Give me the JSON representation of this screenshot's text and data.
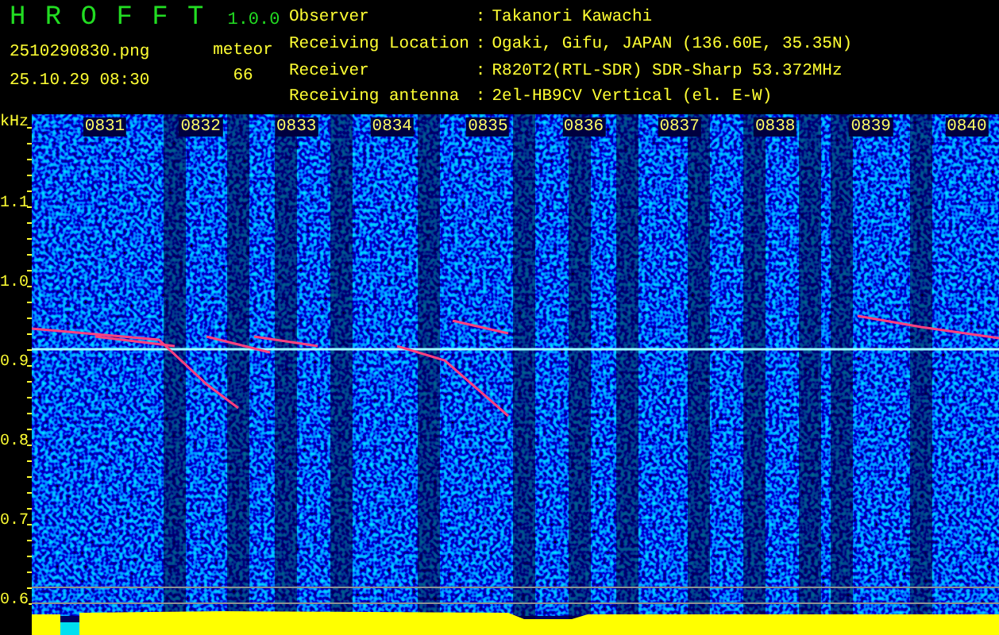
{
  "app": {
    "title": "H R O F F T",
    "version": "1.0.0"
  },
  "file": {
    "name": "2510290830.png",
    "datetime": "25.10.29 08:30"
  },
  "count": {
    "label": "meteor",
    "value": "66"
  },
  "station": [
    {
      "label": "Observer",
      "separator": ":",
      "value": "Takanori Kawachi"
    },
    {
      "label": "Receiving Location",
      "separator": ":",
      "value": "Ogaki, Gifu, JAPAN (136.60E, 35.35N)"
    },
    {
      "label": "Receiver",
      "separator": ":",
      "value": "R820T2(RTL-SDR) SDR-Sharp 53.372MHz"
    },
    {
      "label": "Receiving antenna",
      "separator": ":",
      "value": "2el-HB9CV Vertical (el. E-W)"
    }
  ],
  "spectrogram": {
    "y_unit": "kHz",
    "y_ticks": [
      "1.1",
      "1.0",
      "0.9",
      "0.8",
      "0.7",
      "0.6"
    ],
    "time_labels": [
      "0831",
      "0832",
      "0833",
      "0834",
      "0835",
      "0836",
      "0837",
      "0838",
      "0839",
      "0840"
    ]
  }
}
